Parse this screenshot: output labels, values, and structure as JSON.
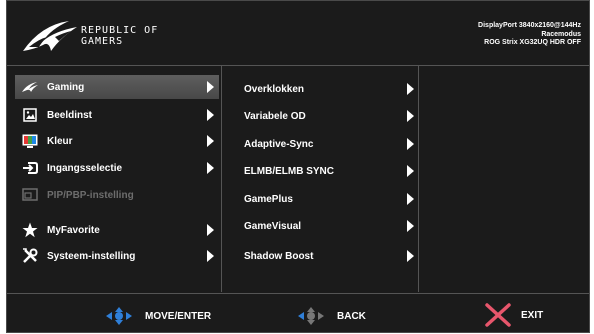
{
  "header": {
    "brand_line1": "REPUBLIC OF",
    "brand_line2": "GAMERS",
    "info_line1": "DisplayPort 3840x2160@144Hz",
    "info_line2": "Racemodus",
    "info_line3": "ROG Strix XG32UQ HDR OFF"
  },
  "menu": [
    {
      "label": "Gaming",
      "icon": "rog-eye-icon"
    },
    {
      "label": "Beeldinst",
      "icon": "image-icon"
    },
    {
      "label": "Kleur",
      "icon": "color-icon"
    },
    {
      "label": "Ingangsselectie",
      "icon": "input-icon"
    },
    {
      "label": "PIP/PBP-instelling",
      "icon": "pip-icon"
    },
    {
      "label": "MyFavorite",
      "icon": "star-icon"
    },
    {
      "label": "Systeem-instelling",
      "icon": "tools-icon"
    }
  ],
  "submenu": [
    {
      "label": "Overklokken"
    },
    {
      "label": "Variabele OD"
    },
    {
      "label": "Adaptive-Sync"
    },
    {
      "label": "ELMB/ELMB SYNC"
    },
    {
      "label": "GamePlus"
    },
    {
      "label": "GameVisual"
    },
    {
      "label": "Shadow Boost"
    }
  ],
  "footer": {
    "move_label": "MOVE/ENTER",
    "back_label": "BACK",
    "exit_label": "EXIT"
  },
  "colors": {
    "background": "#1b1b1b",
    "selected": "#555555",
    "disabled": "#6d6d6d",
    "joystick": "#2f7fd8",
    "exit": "#e8566c"
  }
}
